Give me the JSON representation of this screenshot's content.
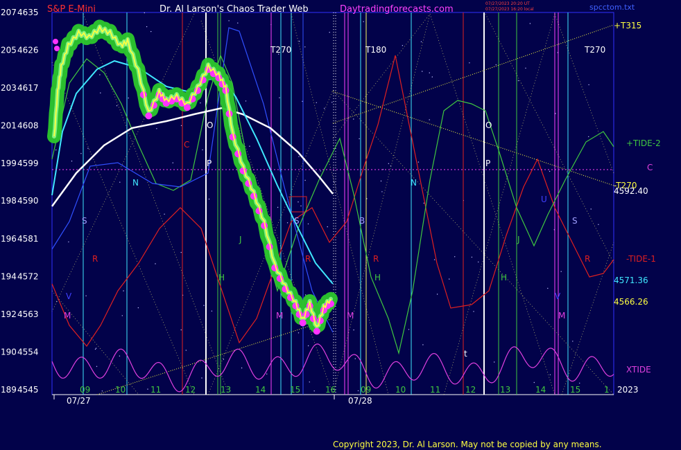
{
  "header": {
    "symbol": "S&P E-Mini",
    "title": "Dr. Al Larson's Chaos Trader Web",
    "site": "Daytradingforecasts.com",
    "timestamp1": "07/27/2023 20:20 UT",
    "timestamp2": "07/27/2023 16:20 local",
    "file": "spcctom.txt"
  },
  "footer": {
    "copyright": "Copyright 2023, Dr. Al Larson. May not be copied by any means."
  },
  "colors": {
    "background": "#02024a",
    "price": "#ffff40",
    "price_glow": "#2cc82c",
    "lows": "#ff33ff",
    "cyan_ma": "#40e8ff",
    "white_ma": "#ffffff",
    "tide2": "#40c840",
    "tide1": "#e02020",
    "xtide": "#e040e0"
  },
  "chart_data": {
    "type": "line",
    "title": "S&P E-Mini",
    "y_left_labels": [
      "207",
      "205",
      "203",
      "201",
      "199",
      "198",
      "196",
      "194",
      "192",
      "190",
      "189"
    ],
    "y_price_labels": [
      "4635",
      "4626",
      "4617",
      "4608",
      "4599",
      "4590",
      "4581",
      "4572",
      "4563",
      "4554",
      "4545"
    ],
    "ylim": [
      4545,
      4635
    ],
    "x_tick_labels": [
      "09",
      "10",
      "11",
      "12",
      "13",
      "14",
      "15",
      "16",
      "09",
      "10",
      "11",
      "12",
      "13",
      "14",
      "15",
      "1"
    ],
    "dates": [
      "07/27",
      "07/28"
    ],
    "year_label": "2023",
    "price_series": [
      {
        "hour": 8.1,
        "price": 4605
      },
      {
        "hour": 8.2,
        "price": 4616
      },
      {
        "hour": 8.3,
        "price": 4622
      },
      {
        "hour": 8.5,
        "price": 4627
      },
      {
        "hour": 8.8,
        "price": 4630
      },
      {
        "hour": 9.1,
        "price": 4629
      },
      {
        "hour": 9.4,
        "price": 4631
      },
      {
        "hour": 9.7,
        "price": 4630
      },
      {
        "hour": 10.0,
        "price": 4627
      },
      {
        "hour": 10.2,
        "price": 4628
      },
      {
        "hour": 10.5,
        "price": 4621
      },
      {
        "hour": 10.8,
        "price": 4611
      },
      {
        "hour": 11.1,
        "price": 4616
      },
      {
        "hour": 11.3,
        "price": 4614
      },
      {
        "hour": 11.6,
        "price": 4615
      },
      {
        "hour": 11.9,
        "price": 4613
      },
      {
        "hour": 12.2,
        "price": 4617
      },
      {
        "hour": 12.5,
        "price": 4622
      },
      {
        "hour": 12.8,
        "price": 4620
      },
      {
        "hour": 13.0,
        "price": 4617
      },
      {
        "hour": 13.2,
        "price": 4606
      },
      {
        "hour": 13.5,
        "price": 4598
      },
      {
        "hour": 13.8,
        "price": 4592
      },
      {
        "hour": 14.1,
        "price": 4585
      },
      {
        "hour": 14.4,
        "price": 4575
      },
      {
        "hour": 14.7,
        "price": 4570
      },
      {
        "hour": 15.0,
        "price": 4566
      },
      {
        "hour": 15.2,
        "price": 4562
      },
      {
        "hour": 15.4,
        "price": 4566
      },
      {
        "hour": 15.6,
        "price": 4560
      },
      {
        "hour": 15.8,
        "price": 4565
      },
      {
        "hour": 16.0,
        "price": 4567
      }
    ],
    "price_labels": [
      {
        "text": "4571.36",
        "color": "#40e8ff"
      },
      {
        "text": "4566.26",
        "color": "#ffff40"
      },
      {
        "text": "4592.40",
        "color": "#ffffff"
      }
    ],
    "lines": [
      {
        "name": "+T315",
        "color": "#ffff40"
      },
      {
        "name": "-T270",
        "color": "#ffff40"
      },
      {
        "name": "+TIDE-2",
        "color": "#40c840"
      },
      {
        "name": "-TIDE-1",
        "color": "#e02020"
      },
      {
        "name": "XTIDE",
        "color": "#e040e0"
      }
    ],
    "markers": [
      {
        "text": "T270",
        "color": "#ffffff"
      },
      {
        "text": "T180",
        "color": "#ffffff"
      },
      {
        "text": "T270",
        "color": "#ffffff"
      },
      {
        "text": "C",
        "color": "#e02020"
      },
      {
        "text": "C",
        "color": "#e040e0"
      },
      {
        "text": "O",
        "color": "#ffffff"
      },
      {
        "text": "P",
        "color": "#ffffff"
      },
      {
        "text": "O",
        "color": "#ffffff"
      },
      {
        "text": "P",
        "color": "#ffffff"
      },
      {
        "text": "N",
        "color": "#40e8ff"
      },
      {
        "text": "N",
        "color": "#40e8ff"
      },
      {
        "text": "S",
        "color": "#a0a0ff"
      },
      {
        "text": "S",
        "color": "#a0a0ff"
      },
      {
        "text": "S",
        "color": "#a0a0ff"
      },
      {
        "text": "R",
        "color": "#e02020"
      },
      {
        "text": "R",
        "color": "#e02020"
      },
      {
        "text": "R",
        "color": "#e02020"
      },
      {
        "text": "R",
        "color": "#e02020"
      },
      {
        "text": "J",
        "color": "#40c840"
      },
      {
        "text": "J",
        "color": "#40c840"
      },
      {
        "text": "H",
        "color": "#40c840"
      },
      {
        "text": "H",
        "color": "#40c840"
      },
      {
        "text": "H",
        "color": "#40c840"
      },
      {
        "text": "M",
        "color": "#e040e0"
      },
      {
        "text": "M",
        "color": "#e040e0"
      },
      {
        "text": "M",
        "color": "#e040e0"
      },
      {
        "text": "M",
        "color": "#e040e0"
      },
      {
        "text": "V",
        "color": "#4040ff"
      },
      {
        "text": "V",
        "color": "#4040ff"
      },
      {
        "text": "B",
        "color": "#a0a0ff"
      },
      {
        "text": "U",
        "color": "#4040ff"
      },
      {
        "text": "t",
        "color": "#ffffff"
      }
    ],
    "grid": false
  }
}
